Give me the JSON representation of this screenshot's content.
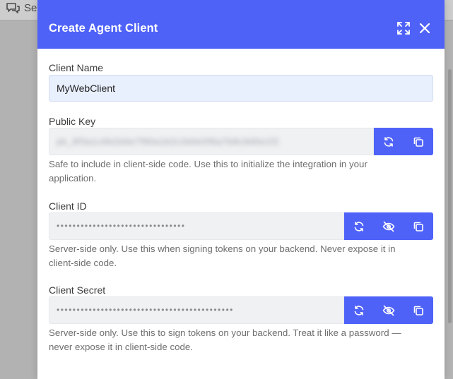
{
  "background": {
    "header_text": "Se"
  },
  "modal": {
    "title": "Create Agent Client",
    "expand_icon": "expand-icon",
    "close_icon": "close-icon"
  },
  "client_name": {
    "label": "Client Name",
    "value": "MyWebClient"
  },
  "public_key": {
    "label": "Public Key",
    "value": "pk_8f3a1c6b2d4e7f90a1b2c3d4e5f6a7b8c9d0e1f2",
    "value_state": "blurred",
    "help": "Safe to include in client-side code. Use this to initialize the integration in your application.",
    "actions": [
      "refresh-icon",
      "copy-icon"
    ]
  },
  "client_id": {
    "label": "Client ID",
    "masked_value": "••••••••••••••••••••••••••••••••",
    "help": "Server-side only. Use this when signing tokens on your backend. Never expose it in client-side code.",
    "actions": [
      "refresh-icon",
      "eye-off-icon",
      "copy-icon"
    ]
  },
  "client_secret": {
    "label": "Client Secret",
    "masked_value": "••••••••••••••••••••••••••••••••••••••••••••",
    "help": "Server-side only. Use this to sign tokens on your backend. Treat it like a password — never expose it in client-side code.",
    "actions": [
      "refresh-icon",
      "eye-off-icon",
      "copy-icon"
    ]
  },
  "colors": {
    "accent": "#4f62f8",
    "overlay": "#b2b2b2",
    "input_highlight": "#e8effd",
    "field_bg": "#f0f1f3",
    "help_text": "#6e6e6e"
  }
}
